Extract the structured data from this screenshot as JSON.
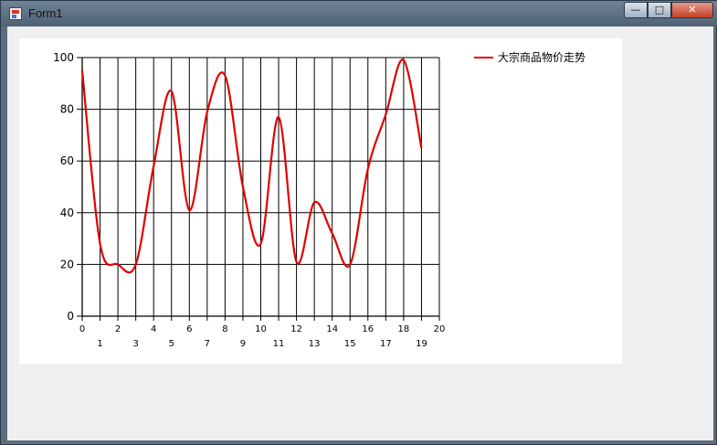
{
  "window": {
    "title": "Form1",
    "controls": {
      "minimize": "—",
      "maximize": "□",
      "close": "✕"
    }
  },
  "icons": {
    "app": "form-icon"
  },
  "colors": {
    "series": "#e00000",
    "grid": "#000000",
    "client_bg": "#efefef",
    "chart_bg": "#ffffff"
  },
  "chart_data": {
    "type": "line",
    "title": "",
    "xlabel": "",
    "ylabel": "",
    "xlim": [
      0,
      20
    ],
    "ylim": [
      0,
      100
    ],
    "x_ticks": [
      0,
      1,
      2,
      3,
      4,
      5,
      6,
      7,
      8,
      9,
      10,
      11,
      12,
      13,
      14,
      15,
      16,
      17,
      18,
      19,
      20
    ],
    "y_ticks": [
      0,
      20,
      40,
      60,
      80,
      100
    ],
    "grid": true,
    "legend": "top-right",
    "series": [
      {
        "name": "大宗商品物价走势",
        "color": "#e00000",
        "smooth": true,
        "x": [
          0,
          1,
          2,
          3,
          4,
          5,
          6,
          7,
          8,
          9,
          10,
          11,
          12,
          13,
          14,
          15,
          16,
          17,
          18,
          19
        ],
        "y": [
          95,
          28,
          20,
          20,
          58,
          87,
          41,
          79,
          93,
          50,
          28,
          77,
          21,
          44,
          32,
          20,
          57,
          78,
          99,
          65
        ]
      }
    ]
  }
}
